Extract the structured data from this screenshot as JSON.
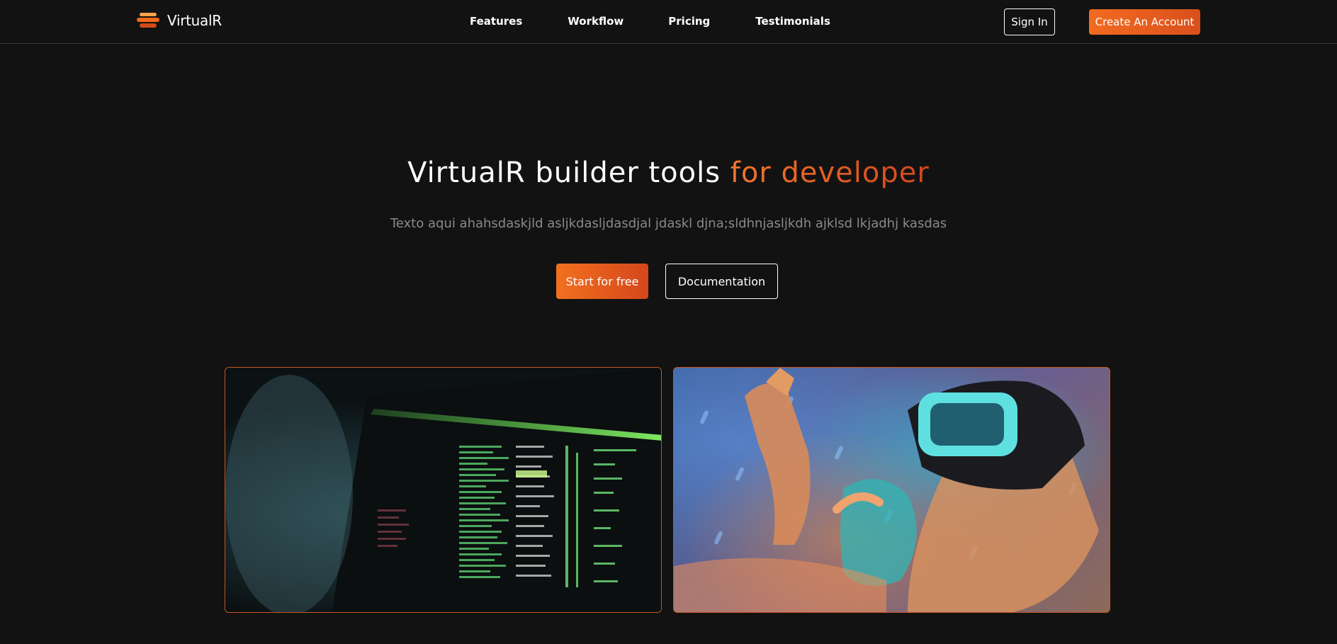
{
  "brand": {
    "name": "VirtualR",
    "logo_icon": "stacked-layers-logo",
    "accent_color": "#f26a1b"
  },
  "nav": {
    "links": [
      "Features",
      "Workflow",
      "Pricing",
      "Testimonials"
    ],
    "sign_in_label": "Sign In",
    "create_account_label": "Create An Account"
  },
  "hero": {
    "title_main": "VirtualR builder tools ",
    "title_accent": "for developer",
    "subtitle": "Texto aqui ahahsdaskjld asljkdasljdasdjal jdaskl djna;sldhnjasljkdh ajklsd lkjadhj kasdas",
    "primary_cta": "Start for free",
    "secondary_cta": "Documentation"
  },
  "images": {
    "left": {
      "description_icon": "terminal-code-image"
    },
    "right": {
      "description_icon": "vr-headset-image"
    }
  },
  "colors": {
    "background": "#121212",
    "accent_start": "#f26b21",
    "accent_end": "#d4471b",
    "muted_text": "#8a8a8a",
    "card_border": "#c45622"
  }
}
